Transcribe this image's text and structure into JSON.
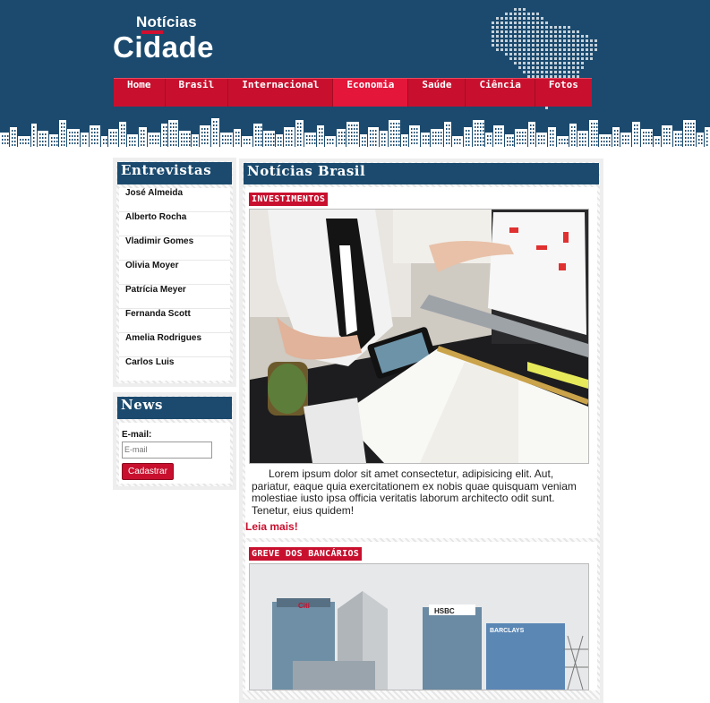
{
  "logo": {
    "top": "Notícias",
    "main": "Cidade"
  },
  "nav": {
    "items": [
      "Home",
      "Brasil",
      "Internacional",
      "Economia",
      "Saúde",
      "Ciência",
      "Fotos"
    ],
    "active": "Economia"
  },
  "sidebar": {
    "interviews": {
      "title": "Entrevistas",
      "items": [
        "José Almeida",
        "Alberto Rocha",
        "Vladimir Gomes",
        "Olivia Moyer",
        "Patrícia Meyer",
        "Fernanda Scott",
        "Amelia Rodrigues",
        "Carlos Luis"
      ]
    },
    "newsletter": {
      "title": "News",
      "email_label": "E-mail:",
      "email_placeholder": "E-mail",
      "submit_label": "Cadastrar"
    }
  },
  "main": {
    "title": "Notícias Brasil",
    "articles": [
      {
        "tag": "INVESTIMENTOS",
        "excerpt": "Lorem ipsum dolor sit amet consectetur, adipisicing elit. Aut, pariatur, eaque quia exercitationem ex nobis quae quisquam veniam molestiae iusto ipsa officia veritatis laborum architecto odit sunt. Tenetur, eius quidem!",
        "more_label": "Leia mais!"
      },
      {
        "tag": "GREVE DOS BANCÁRIOS",
        "signs": [
          "Citi",
          "HSBC",
          "BARCLAYS"
        ]
      }
    ]
  },
  "colors": {
    "navy": "#1b4a6e",
    "red": "#c8102e"
  }
}
